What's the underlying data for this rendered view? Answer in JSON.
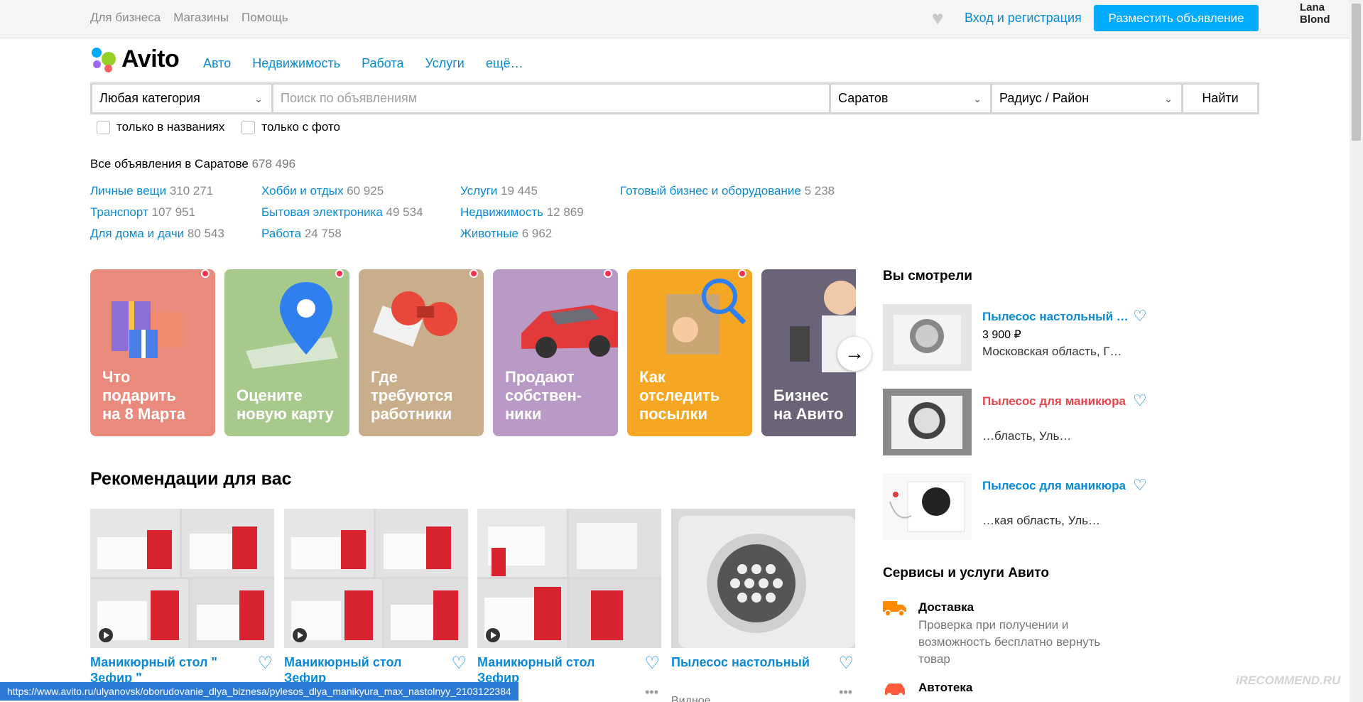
{
  "topbar": {
    "links": [
      "Для бизнеса",
      "Магазины",
      "Помощь"
    ],
    "login": "Вход и регистрация",
    "post_ad": "Разместить объявление",
    "user": "Lana Blond"
  },
  "header": {
    "logo": "Avito",
    "nav": [
      "Авто",
      "Недвижимость",
      "Работа",
      "Услуги",
      "ещё…"
    ]
  },
  "search": {
    "category": "Любая категория",
    "placeholder": "Поиск по объявлениям",
    "city": "Саратов",
    "radius": "Радиус / Район",
    "button": "Найти",
    "only_titles": "только в названиях",
    "only_photo": "только с фото"
  },
  "summary": {
    "label": "Все объявления в Саратове",
    "count": "678 496"
  },
  "categories": [
    [
      {
        "name": "Личные вещи",
        "count": "310 271"
      },
      {
        "name": "Транспорт",
        "count": "107 951"
      },
      {
        "name": "Для дома и дачи",
        "count": "80 543"
      }
    ],
    [
      {
        "name": "Хобби и отдых",
        "count": "60 925"
      },
      {
        "name": "Бытовая электроника",
        "count": "49 534"
      },
      {
        "name": "Работа",
        "count": "24 758"
      }
    ],
    [
      {
        "name": "Услуги",
        "count": "19 445"
      },
      {
        "name": "Недвижимость",
        "count": "12 869"
      },
      {
        "name": "Животные",
        "count": "6 962"
      }
    ],
    [
      {
        "name": "Готовый бизнес и оборудование",
        "count": "5 238"
      }
    ]
  ],
  "stories": [
    {
      "text": "Что\nподарить\nна 8 Марта",
      "color": "#e88a7c"
    },
    {
      "text": "Оцените\nновую карту",
      "color": "#a8c98c"
    },
    {
      "text": "Где\nтребуются\nработники",
      "color": "#c9ae8c"
    },
    {
      "text": "Продают\nсобствен-\nники",
      "color": "#b99ac7"
    },
    {
      "text": "Как\nотследить\nпосылки",
      "color": "#f5a623"
    },
    {
      "text": "Бизнес\nна Авито",
      "color": "#6b6478"
    }
  ],
  "recommendations": {
    "title": "Рекомендации для вас",
    "items": [
      {
        "title": "Маникюрный стол \" Зефир \""
      },
      {
        "title": "Маникюрный стол Зефир"
      },
      {
        "title": "Маникюрный стол Зефир"
      },
      {
        "title": "Пылесос настольный"
      }
    ],
    "partial_location": "Видное"
  },
  "seen": {
    "title": "Вы смотрели",
    "items": [
      {
        "title": "Пылесос настольный для маникюра",
        "price": "3 900 ₽",
        "location": "Московская область, Г…"
      },
      {
        "title": "Пылесос для маникюра",
        "price": "",
        "location": "…бласть, Уль…"
      },
      {
        "title": "Пылесос для маникюра",
        "price": "",
        "location": "…кая область, Уль…"
      }
    ]
  },
  "services": {
    "title": "Сервисы и услуги Авито",
    "delivery": {
      "name": "Доставка",
      "desc": "Проверка при получении и возможность бесплатно вернуть товар"
    },
    "autoteka": {
      "name": "Автотека"
    }
  },
  "status_url": "https://www.avito.ru/ulyanovsk/oborudovanie_dlya_biznesa/pylesos_dlya_manikyura_max_nastolnyy_2103122384",
  "watermark": "iRECOMMEND.RU"
}
